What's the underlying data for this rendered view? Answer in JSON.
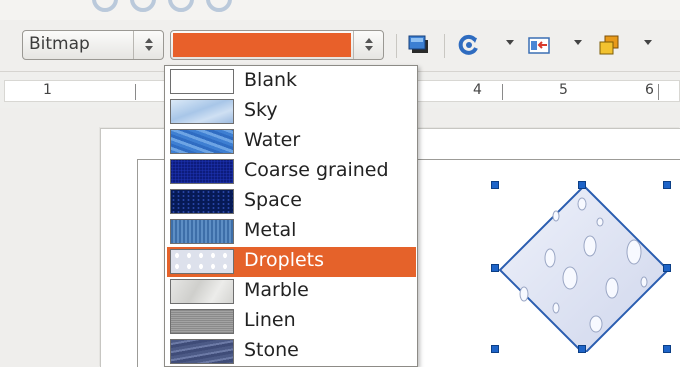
{
  "toolbar": {
    "area_style": "Bitmap",
    "current_fill_color": "#e8602a",
    "icons": [
      "shadow-icon",
      "rotate-icon",
      "align-icon",
      "arrange-icon"
    ]
  },
  "ruler": {
    "marks": [
      "1",
      "4",
      "5",
      "6"
    ]
  },
  "bitmap_list": {
    "selected": "Droplets",
    "items": [
      {
        "label": "Blank",
        "texture": "blank"
      },
      {
        "label": "Sky",
        "texture": "sky"
      },
      {
        "label": "Water",
        "texture": "water"
      },
      {
        "label": "Coarse grained",
        "texture": "coarse"
      },
      {
        "label": "Space",
        "texture": "space"
      },
      {
        "label": "Metal",
        "texture": "metal"
      },
      {
        "label": "Droplets",
        "texture": "droplets"
      },
      {
        "label": "Marble",
        "texture": "marble"
      },
      {
        "label": "Linen",
        "texture": "linen"
      },
      {
        "label": "Stone",
        "texture": "stone"
      }
    ]
  },
  "colors": {
    "selection_accent": "#e5622a",
    "handle_blue": "#1e64c8",
    "shape_fill": "#dfe4f4",
    "shape_outline": "#2a5db0"
  }
}
